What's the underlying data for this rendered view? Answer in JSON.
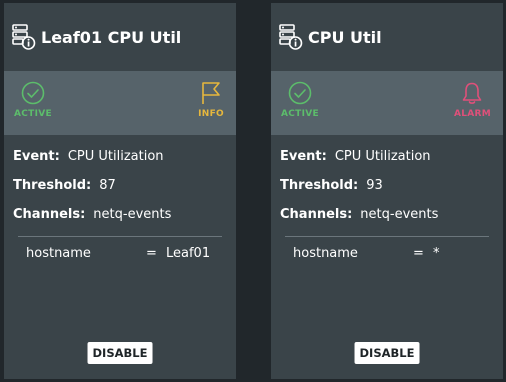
{
  "colors": {
    "background": "#21272b",
    "card": "#3a4449",
    "status_bar": "#56636a",
    "active": "#5cbd6b",
    "info": "#e6b73d",
    "alarm": "#e0507a"
  },
  "cards": [
    {
      "title": "Leaf01 CPU Util",
      "status": {
        "label": "ACTIVE",
        "icon": "check-circle-icon"
      },
      "severity": {
        "label": "INFO",
        "icon": "flag-icon"
      },
      "details": [
        {
          "key": "Event:",
          "value": "CPU Utilization"
        },
        {
          "key": "Threshold:",
          "value": "87"
        },
        {
          "key": "Channels:",
          "value": "netq-events"
        }
      ],
      "filter": {
        "key": "hostname",
        "op": "=",
        "value": "Leaf01"
      },
      "button_label": "DISABLE"
    },
    {
      "title": "CPU Util",
      "status": {
        "label": "ACTIVE",
        "icon": "check-circle-icon"
      },
      "severity": {
        "label": "ALARM",
        "icon": "bell-icon"
      },
      "details": [
        {
          "key": "Event:",
          "value": "CPU Utilization"
        },
        {
          "key": "Threshold:",
          "value": "93"
        },
        {
          "key": "Channels:",
          "value": "netq-events"
        }
      ],
      "filter": {
        "key": "hostname",
        "op": "=",
        "value": "*"
      },
      "button_label": "DISABLE"
    }
  ]
}
